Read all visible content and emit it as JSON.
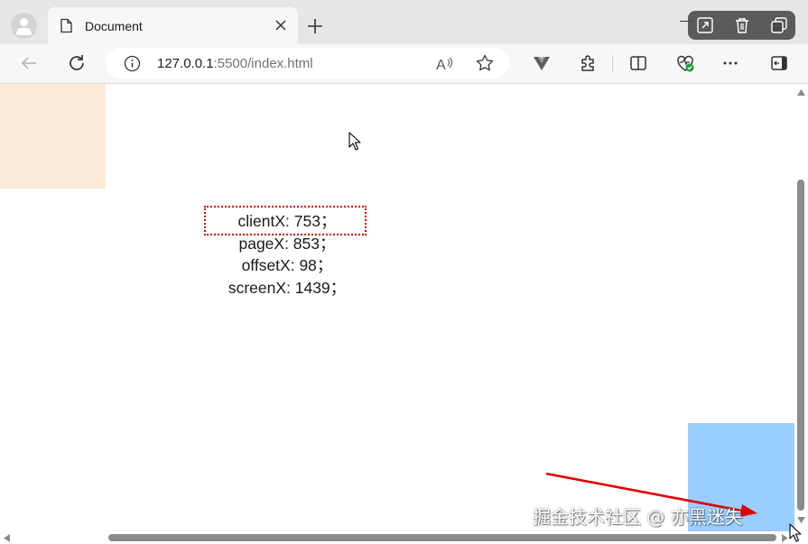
{
  "browser": {
    "tab": {
      "title": "Document",
      "icon": "document-icon"
    },
    "address_bar": {
      "url_main": "127.0.0.1",
      "url_rest": ":5500/index.html"
    },
    "colors": {
      "tab_strip": "#e6e6e6",
      "toolbar": "#f7f7f7"
    }
  },
  "page": {
    "coords": [
      {
        "label": "clientX: 753；"
      },
      {
        "label": "pageX: 853；"
      },
      {
        "label": "offsetX: 98；"
      },
      {
        "label": "screenX: 1439；"
      }
    ],
    "colors": {
      "peach_box": "#fbebd7",
      "blue_box": "#99ceff",
      "highlight": "#cc0000",
      "arrow": "#dd0000"
    }
  },
  "watermark": "掘金技术社区 @ 亦黑迷失"
}
